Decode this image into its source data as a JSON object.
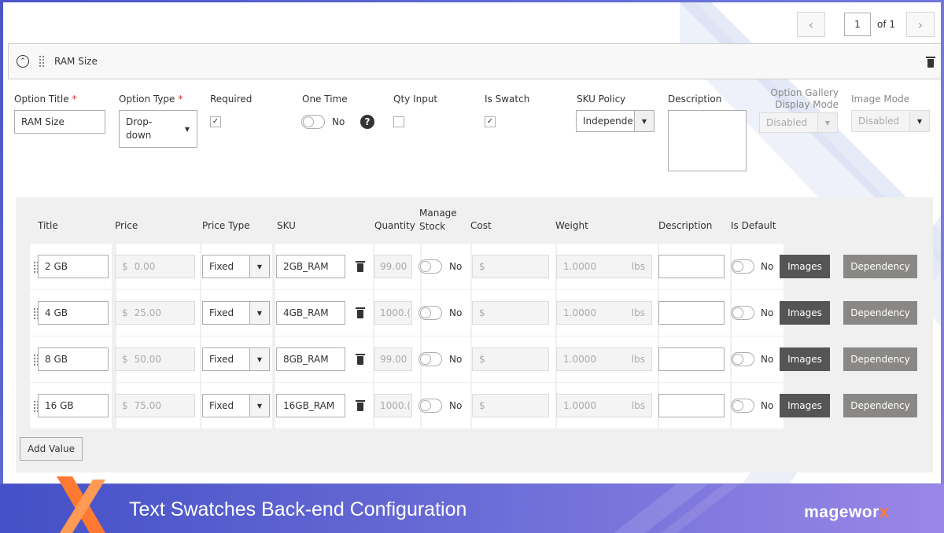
{
  "pager": {
    "page": "1",
    "of_label": "of 1",
    "prev_icon": "chevron-left-icon",
    "next_icon": "chevron-right-icon"
  },
  "option": {
    "header_title": "RAM Size",
    "labels": {
      "option_title": "Option Title",
      "option_type": "Option Type",
      "required": "Required",
      "one_time": "One Time",
      "qty_input": "Qty Input",
      "is_swatch": "Is Swatch",
      "sku_policy": "SKU Policy",
      "description": "Description",
      "gallery_line1": "Option Gallery",
      "gallery_line2": "Display Mode",
      "image_mode": "Image Mode"
    },
    "required_mark": "*",
    "title_value": "RAM Size",
    "type_line1": "Drop-",
    "type_line2": "down",
    "one_time_state": "No",
    "sku_policy_value": "Independe",
    "gallery_value": "Disabled",
    "image_mode_value": "Disabled",
    "required_checked": "✓",
    "swatch_checked": "✓",
    "help_icon": "?"
  },
  "table": {
    "headers": {
      "title": "Title",
      "price": "Price",
      "price_type": "Price Type",
      "sku": "SKU",
      "quantity": "Quantity",
      "manage_line1": "Manage",
      "manage_line2": "Stock",
      "cost": "Cost",
      "weight": "Weight",
      "description": "Description",
      "is_default": "Is Default"
    },
    "rows": [
      {
        "title": "2 GB",
        "currency": "$",
        "price": "0.00",
        "price_type": "Fixed",
        "sku": "2GB_RAM",
        "qty": "99.00",
        "stock": "No",
        "cost_currency": "$",
        "weight": "1.0000",
        "unit": "lbs",
        "default": "No",
        "images": "Images",
        "dependency": "Dependency"
      },
      {
        "title": "4 GB",
        "currency": "$",
        "price": "25.00",
        "price_type": "Fixed",
        "sku": "4GB_RAM",
        "qty": "1000.(",
        "stock": "No",
        "cost_currency": "$",
        "weight": "1.0000",
        "unit": "lbs",
        "default": "No",
        "images": "Images",
        "dependency": "Dependency"
      },
      {
        "title": "8 GB",
        "currency": "$",
        "price": "50.00",
        "price_type": "Fixed",
        "sku": "8GB_RAM",
        "qty": "99.00",
        "stock": "No",
        "cost_currency": "$",
        "weight": "1.0000",
        "unit": "lbs",
        "default": "No",
        "images": "Images",
        "dependency": "Dependency"
      },
      {
        "title": "16 GB",
        "currency": "$",
        "price": "75.00",
        "price_type": "Fixed",
        "sku": "16GB_RAM",
        "qty": "1000.(",
        "stock": "No",
        "cost_currency": "$",
        "weight": "1.0000",
        "unit": "lbs",
        "default": "No",
        "images": "Images",
        "dependency": "Dependency"
      }
    ],
    "add_value": "Add Value"
  },
  "banner": {
    "title": "Text Swatches Back-end Configuration",
    "brand_main": "magewor",
    "brand_x": "x"
  },
  "colors": {
    "accent_orange": "#ff7a30",
    "banner_blue": "#4a55c8",
    "dark_button": "#555555",
    "gray_button": "#8a8886"
  }
}
